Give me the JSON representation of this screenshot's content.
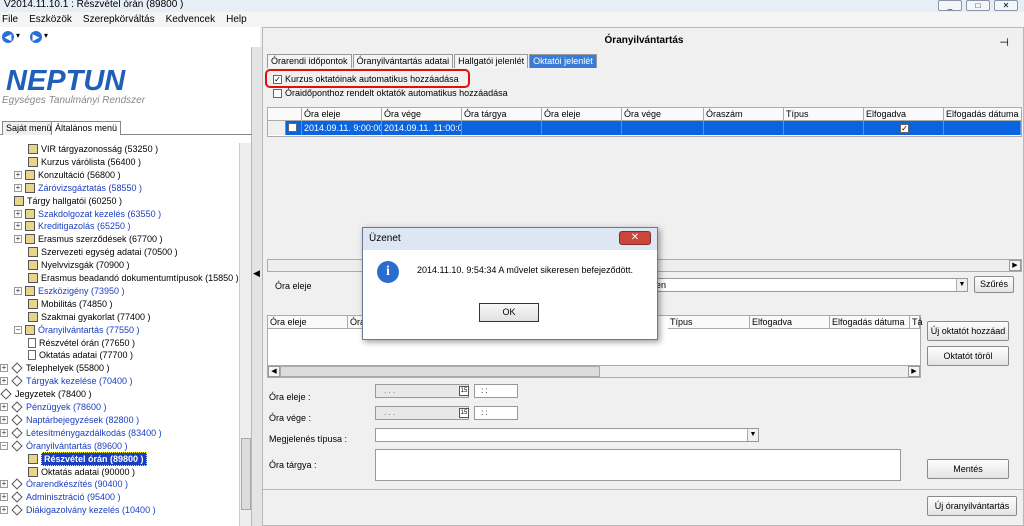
{
  "window": {
    "title": "V2014.11.10.1 : Részvétel órán (89800 )",
    "controls": [
      "_",
      "□",
      "✕"
    ]
  },
  "menu": [
    "File",
    "Eszközök",
    "Szerepkörváltás",
    "Kedvencek",
    "Help"
  ],
  "logo": {
    "name": "NEPTUN",
    "subtitle": "Egységes Tanulmányi Rendszer"
  },
  "left_tabs": [
    "Saját menü",
    "Általános menü"
  ],
  "tree": [
    {
      "label": "VIR tárgyazonosság (53250 )",
      "link": false
    },
    {
      "label": "Kurzus várólista (56400 )",
      "link": false
    },
    {
      "label": "Konzultáció (56800 )",
      "link": false
    },
    {
      "label": "Záróvizsgáztatás (58550 )",
      "link": true
    },
    {
      "label": "Tárgy hallgatói (60250 )",
      "link": false
    },
    {
      "label": "Szakdolgozat kezelés (63550 )",
      "link": true
    },
    {
      "label": "Kreditigazolás (65250 )",
      "link": true
    },
    {
      "label": "Erasmus szerződések (67700 )",
      "link": false
    },
    {
      "label": "Szervezeti egység adatai (70500 )",
      "link": false
    },
    {
      "label": "Nyelvvizsgák (70900 )",
      "link": false
    },
    {
      "label": "Erasmus beadandó dokumentumtípusok (15850 )",
      "link": false
    },
    {
      "label": "Eszközigény (73950 )",
      "link": true
    },
    {
      "label": "Mobilitás (74850 )",
      "link": false
    },
    {
      "label": "Szakmai gyakorlat (77400 )",
      "link": false
    },
    {
      "label": "Óranyilvántartás (77550 )",
      "link": true
    },
    {
      "label": "Részvétel órán (77650 )",
      "link": false
    },
    {
      "label": "Oktatás adatai (77700 )",
      "link": false
    },
    {
      "label": "Telephelyek (55800 )",
      "link": false
    },
    {
      "label": "Tárgyak kezelése (70400 )",
      "link": true
    },
    {
      "label": "Jegyzetek (78400 )",
      "link": false
    },
    {
      "label": "Pénzügyek (78600 )",
      "link": true
    },
    {
      "label": "Naptárbejegyzések (82800 )",
      "link": true
    },
    {
      "label": "Létesítménygazdálkodás (83400 )",
      "link": true
    },
    {
      "label": "Óranyilvántartás (89600 )",
      "link": true
    },
    {
      "label": "Részvétel órán (89800 )",
      "link": false,
      "selected": true
    },
    {
      "label": "Oktatás adatai (90000 )",
      "link": false
    },
    {
      "label": "Órarendkészítés (90400 )",
      "link": true
    },
    {
      "label": "Adminisztráció (95400 )",
      "link": true
    },
    {
      "label": "Diákigazolvány kezelés (10400 )",
      "link": true
    }
  ],
  "main": {
    "title": "Óranyilvántartás",
    "tabs": [
      "Órarendi időpontok",
      "Óranyilvántartás adatai",
      "Hallgatói jelenlét",
      "Oktatói jelenlét"
    ],
    "checkbox1": "Kurzus oktatóinak automatikus hozzáadása",
    "checkbox2": "Óraidőponthoz rendelt oktatók automatikus hozzáadása",
    "grid1": {
      "columns": [
        "Óra eleje",
        "Óra vége",
        "Óra tárgya",
        "Óra eleje",
        "Óra vége",
        "Óraszám",
        "Típus",
        "Elfogadva",
        "Elfogadás dátuma"
      ],
      "row": [
        "2014.09.11. 9:00:00",
        "2014.09.11. 11:00:0",
        "",
        "",
        "",
        "",
        "",
        "✓",
        ""
      ]
    },
    "filter": {
      "label": "Óra eleje",
      "select_value": "en",
      "button": "Szűrés"
    },
    "grid2": {
      "columns": [
        "Óra eleje",
        "Óra",
        "",
        "",
        "",
        "Típus",
        "Elfogadva",
        "Elfogadás dátuma",
        "Tá"
      ]
    },
    "buttons": {
      "add_teacher": "Új oktatót hozzáad",
      "remove_teacher": "Oktatót töröl",
      "save": "Mentés",
      "new_record": "Új óranyilvántartás"
    },
    "form": {
      "start_label": "Óra eleje :",
      "end_label": "Óra vége :",
      "display_type_label": "Megjelenés típusa :",
      "subject_label": "Óra tárgya :",
      "date_placeholder": ". . .",
      "time_placeholder": ": :"
    }
  },
  "dialog": {
    "title": "Üzenet",
    "message": "2014.11.10. 9:54:34  A művelet sikeresen befejeződött.",
    "ok": "OK",
    "close": "✕"
  }
}
